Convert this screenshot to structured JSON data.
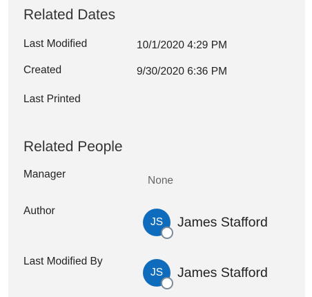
{
  "related_dates": {
    "title": "Related Dates",
    "last_modified_label": "Last Modified",
    "last_modified_value": "10/1/2020 4:29 PM",
    "created_label": "Created",
    "created_value": "9/30/2020 6:36 PM",
    "last_printed_label": "Last Printed"
  },
  "related_people": {
    "title": "Related People",
    "manager_label": "Manager",
    "manager_value": "None",
    "author_label": "Author",
    "author": {
      "initials": "JS",
      "name": "James Stafford"
    },
    "last_modified_by_label": "Last Modified By",
    "last_modified_by": {
      "initials": "JS",
      "name": "James Stafford"
    }
  },
  "colors": {
    "panel_background": "#f3f3f3",
    "avatar_background": "#0f6cbd",
    "presence_ring": "#7a8a99"
  }
}
